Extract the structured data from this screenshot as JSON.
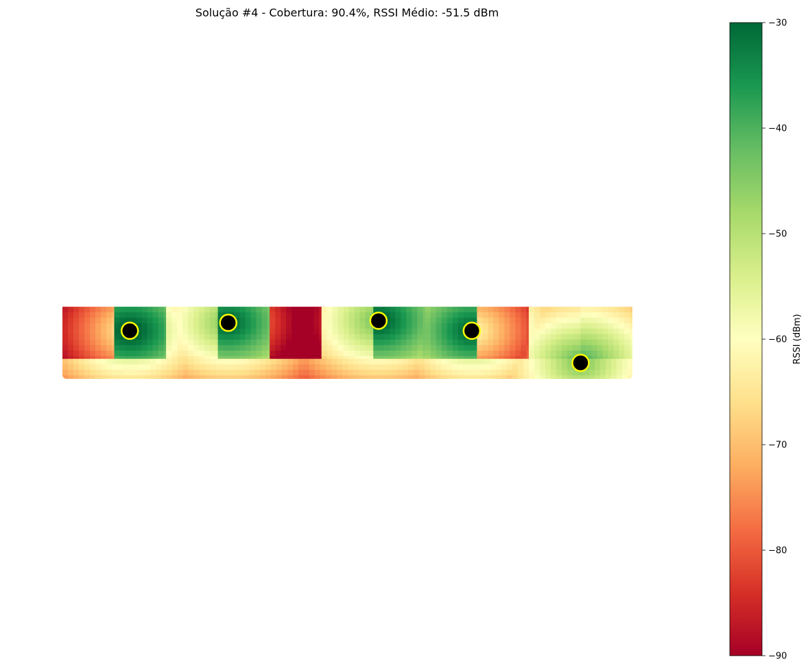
{
  "chart_data": {
    "type": "heatmap",
    "title": "Solução #4 - Cobertura: 90.4%, RSSI Médio: -51.5 dBm",
    "xlabel": "",
    "ylabel": "",
    "axes_visible": false,
    "colorbar": {
      "label": "RSSI (dBm)",
      "range": [
        -90,
        -30
      ],
      "ticks": [
        -30,
        -40,
        -50,
        -60,
        -70,
        -80,
        -90
      ],
      "tick_labels": [
        "−30",
        "−40",
        "−50",
        "−60",
        "−70",
        "−80",
        "−90"
      ],
      "colormap": "RdYlGn",
      "colors": [
        "#a50026",
        "#d73027",
        "#f46d43",
        "#fdae61",
        "#fee08b",
        "#ffffbf",
        "#d9ef8b",
        "#a6d96a",
        "#66bd63",
        "#1a9850",
        "#006837"
      ]
    },
    "access_points": [
      {
        "x": 1.3,
        "y": 4.6
      },
      {
        "x": 3.2,
        "y": 4.8
      },
      {
        "x": 6.1,
        "y": 4.85
      },
      {
        "x": 7.9,
        "y": 4.6
      },
      {
        "x": 10.0,
        "y": 3.8
      }
    ],
    "access_point_style": {
      "fill": "#000000",
      "edge": "#ffff00"
    },
    "rooms": [
      {
        "x": [
          0,
          1
        ],
        "y": [
          3.9,
          5.2
        ],
        "rssi": -74
      },
      {
        "x": [
          1,
          2
        ],
        "y": [
          3.9,
          5.2
        ],
        "rssi": -38
      },
      {
        "x": [
          2,
          3
        ],
        "y": [
          3.9,
          5.2
        ],
        "rssi": -55
      },
      {
        "x": [
          3,
          4
        ],
        "y": [
          3.9,
          5.2
        ],
        "rssi": -40
      },
      {
        "x": [
          4,
          5
        ],
        "y": [
          3.9,
          5.2
        ],
        "rssi": -79
      },
      {
        "x": [
          5,
          6
        ],
        "y": [
          3.9,
          5.2
        ],
        "rssi": -54
      },
      {
        "x": [
          6,
          7
        ],
        "y": [
          3.9,
          5.2
        ],
        "rssi": -39
      },
      {
        "x": [
          7,
          8
        ],
        "y": [
          3.9,
          5.2
        ],
        "rssi": -40
      },
      {
        "x": [
          8,
          9
        ],
        "y": [
          3.9,
          5.2
        ],
        "rssi": -73
      },
      {
        "x": [
          9,
          10
        ],
        "y": [
          3.9,
          5.2
        ],
        "rssi": -52
      },
      {
        "x": [
          10,
          11
        ],
        "y": [
          3.9,
          5.2
        ],
        "rssi": -50
      }
    ],
    "corridor": {
      "x": [
        0,
        11
      ],
      "y": [
        3.4,
        3.9
      ],
      "rssi": -55
    },
    "domain": {
      "x": [
        0,
        11
      ],
      "y": [
        3.4,
        5.4
      ]
    }
  }
}
